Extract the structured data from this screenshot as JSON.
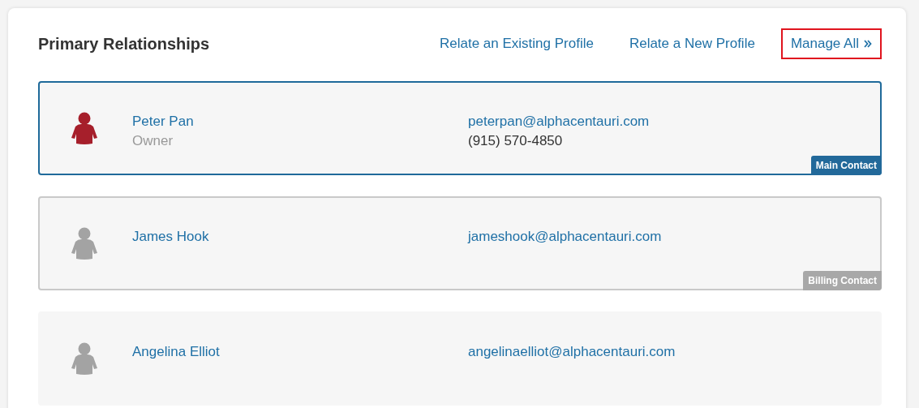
{
  "title": "Primary Relationships",
  "actions": [
    {
      "kind": "link",
      "label": "Relate an Existing Profile",
      "highlighted": false
    },
    {
      "kind": "link",
      "label": "Relate a New Profile",
      "highlighted": false
    },
    {
      "kind": "more",
      "label": "Manage All",
      "highlighted": true
    }
  ],
  "contacts": [
    {
      "kind": "main",
      "name": "Peter Pan",
      "role": "Owner",
      "email": "peterpan@alphacentauri.com",
      "phone": "(915) 570-4850",
      "badge": "Main Contact"
    },
    {
      "kind": "billing",
      "name": "James Hook",
      "email": "jameshook@alphacentauri.com",
      "badge": "Billing Contact"
    },
    {
      "kind": "plain",
      "name": "Angelina Elliot",
      "email": "angelinaelliot@alphacentauri.com"
    }
  ]
}
